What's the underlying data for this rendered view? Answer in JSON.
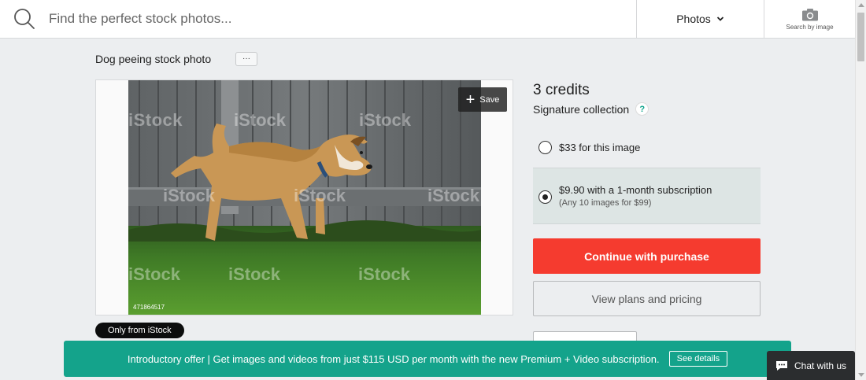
{
  "search": {
    "placeholder": "Find the perfect stock photos...",
    "media_type": "Photos",
    "search_by_image_label": "Search by image"
  },
  "photo": {
    "title": "Dog peeing stock photo",
    "more_label": "···",
    "save_label": "Save",
    "id": "471864517",
    "watermark": "iStock",
    "badge": "Only from iStock"
  },
  "pricing": {
    "credits": "3 credits",
    "collection": "Signature collection",
    "help": "?",
    "option_single": "$33 for this image",
    "option_subscription": "$9.90 with a 1-month subscription",
    "option_subscription_note": "(Any 10 images for $99)",
    "selected_option": "subscription",
    "continue_label": "Continue with purchase",
    "plans_label": "View plans and pricing"
  },
  "promo": {
    "text": "Introductory offer | Get images and videos from just $115 USD per month with the new Premium + Video subscription.",
    "button": "See details"
  },
  "chat": {
    "label": "Chat with us"
  },
  "colors": {
    "accent_red": "#f53b2f",
    "accent_teal": "#14a38b",
    "selected_bg": "#dde5e4"
  }
}
